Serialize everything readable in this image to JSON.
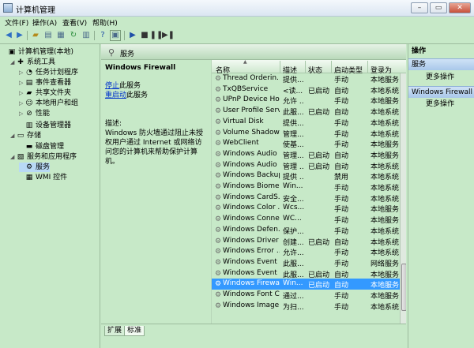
{
  "window": {
    "title": "计算机管理"
  },
  "menu": [
    "文件(F)",
    "操作(A)",
    "查看(V)",
    "帮助(H)"
  ],
  "tree": [
    {
      "label": "计算机管理(本地)",
      "level": 0,
      "arrow": "",
      "icon": "computer-icon",
      "glyph": "▣"
    },
    {
      "label": "系统工具",
      "level": 1,
      "arrow": "◢",
      "icon": "tools-icon",
      "glyph": "✚"
    },
    {
      "label": "任务计划程序",
      "level": 2,
      "arrow": "▷",
      "icon": "clock-icon",
      "glyph": "◔"
    },
    {
      "label": "事件查看器",
      "level": 2,
      "arrow": "▷",
      "icon": "event-viewer-icon",
      "glyph": "▤"
    },
    {
      "label": "共享文件夹",
      "level": 2,
      "arrow": "▷",
      "icon": "shared-folder-icon",
      "glyph": "▰"
    },
    {
      "label": "本地用户和组",
      "level": 2,
      "arrow": "▷",
      "icon": "users-icon",
      "glyph": "☺"
    },
    {
      "label": "性能",
      "level": 2,
      "arrow": "▷",
      "icon": "performance-icon",
      "glyph": "⊘"
    },
    {
      "label": "设备管理器",
      "level": 2,
      "arrow": "",
      "icon": "device-manager-icon",
      "glyph": "▥"
    },
    {
      "label": "存储",
      "level": 1,
      "arrow": "◢",
      "icon": "storage-icon",
      "glyph": "▭"
    },
    {
      "label": "磁盘管理",
      "level": 2,
      "arrow": "",
      "icon": "disk-icon",
      "glyph": "▬"
    },
    {
      "label": "服务和应用程序",
      "level": 1,
      "arrow": "◢",
      "icon": "services-apps-icon",
      "glyph": "▧"
    },
    {
      "label": "服务",
      "level": 2,
      "arrow": "",
      "icon": "services-icon",
      "glyph": "⚙"
    },
    {
      "label": "WMI 控件",
      "level": 2,
      "arrow": "",
      "icon": "wmi-icon",
      "glyph": "▦"
    }
  ],
  "center": {
    "header": "服务",
    "detail": {
      "name": "Windows Firewall",
      "stop_link": "停止",
      "stop_rest": "此服务",
      "restart_link": "重启动",
      "restart_rest": "此服务",
      "desc": "描述:\nWindows 防火墙通过阻止未授权用户通过 Internet 或网络访问您的计算机来帮助保护计算机。"
    },
    "columns": {
      "name": "名称",
      "desc": "描述",
      "status": "状态",
      "startup": "启动类型",
      "logon": "登录为"
    },
    "rows": [
      {
        "name": "Thread Orderin...",
        "desc": "提供...",
        "status": "",
        "startup": "手动",
        "logon": "本地服务"
      },
      {
        "name": "TxQBService",
        "desc": "<读...",
        "status": "已启动",
        "startup": "自动",
        "logon": "本地系统"
      },
      {
        "name": "UPnP Device Host",
        "desc": "允许 ...",
        "status": "",
        "startup": "手动",
        "logon": "本地服务"
      },
      {
        "name": "User Profile Serv...",
        "desc": "此服...",
        "status": "已启动",
        "startup": "自动",
        "logon": "本地系统"
      },
      {
        "name": "Virtual Disk",
        "desc": "提供...",
        "status": "",
        "startup": "手动",
        "logon": "本地系统"
      },
      {
        "name": "Volume Shadow...",
        "desc": "管理...",
        "status": "",
        "startup": "手动",
        "logon": "本地系统"
      },
      {
        "name": "WebClient",
        "desc": "使基...",
        "status": "",
        "startup": "手动",
        "logon": "本地服务"
      },
      {
        "name": "Windows Audio",
        "desc": "管理...",
        "status": "已启动",
        "startup": "自动",
        "logon": "本地服务"
      },
      {
        "name": "Windows Audio ...",
        "desc": "管理 ...",
        "status": "已启动",
        "startup": "自动",
        "logon": "本地系统"
      },
      {
        "name": "Windows Backup",
        "desc": "提供 ...",
        "status": "",
        "startup": "禁用",
        "logon": "本地系统"
      },
      {
        "name": "Windows Biome...",
        "desc": "Win...",
        "status": "",
        "startup": "手动",
        "logon": "本地系统"
      },
      {
        "name": "Windows CardS...",
        "desc": "安全...",
        "status": "",
        "startup": "手动",
        "logon": "本地系统"
      },
      {
        "name": "Windows Color ...",
        "desc": "Wcs...",
        "status": "",
        "startup": "手动",
        "logon": "本地服务"
      },
      {
        "name": "Windows Conne...",
        "desc": "WC...",
        "status": "",
        "startup": "手动",
        "logon": "本地服务"
      },
      {
        "name": "Windows Defen...",
        "desc": "保护...",
        "status": "",
        "startup": "手动",
        "logon": "本地系统"
      },
      {
        "name": "Windows Driver ...",
        "desc": "创建...",
        "status": "已启动",
        "startup": "自动",
        "logon": "本地系统"
      },
      {
        "name": "Windows Error ...",
        "desc": "允许...",
        "status": "",
        "startup": "手动",
        "logon": "本地系统"
      },
      {
        "name": "Windows Event ...",
        "desc": "此服...",
        "status": "",
        "startup": "手动",
        "logon": "网络服务"
      },
      {
        "name": "Windows Event ...",
        "desc": "此服...",
        "status": "已启动",
        "startup": "自动",
        "logon": "本地服务"
      },
      {
        "name": "Windows Firewall",
        "desc": "Win...",
        "status": "已启动",
        "startup": "自动",
        "logon": "本地服务"
      },
      {
        "name": "Windows Font C...",
        "desc": "通过...",
        "status": "",
        "startup": "手动",
        "logon": "本地服务"
      },
      {
        "name": "Windows Image...",
        "desc": "为扫...",
        "status": "",
        "startup": "手动",
        "logon": "本地系统"
      }
    ],
    "selected_row": 19,
    "tabs": [
      "扩展",
      "标准"
    ]
  },
  "actions": {
    "title": "操作",
    "sections": [
      {
        "title": "服务",
        "item": "更多操作"
      },
      {
        "title": "Windows Firewall",
        "item": "更多操作"
      }
    ]
  }
}
